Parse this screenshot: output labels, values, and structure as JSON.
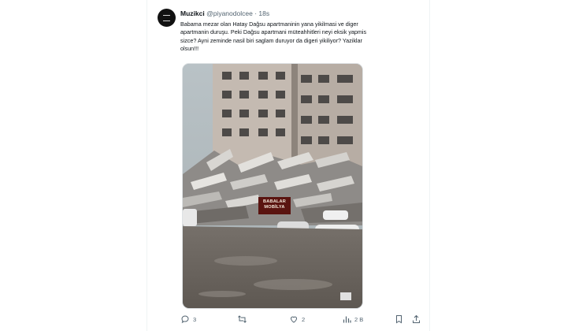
{
  "tweet": {
    "author_name": "Muzikci",
    "author_handle": "@piyanodolcee",
    "separator": "·",
    "timestamp": "18s",
    "text": "Babama mezar olan Hatay Dağsu apartmaninin yana yikilmasi ve diger\napartmanin duruşu. Peki Dağsu apartmani müteahhitleri neyi eksik yapmis\nsizce? Ayni zeminde nasil biri saglam duruyor da digeri yikiliyor? Yaziklar\nolsun!!!",
    "media": {
      "sign_text_line1": "BABALAR",
      "sign_text_line2": "MOBİLYA"
    },
    "actions": {
      "reply_count": "3",
      "retweet_count": "",
      "like_count": "2",
      "view_count": "2 B"
    }
  },
  "colors": {
    "text_primary": "#0f1419",
    "text_secondary": "#536471",
    "divider": "#eff3f4"
  },
  "icons": [
    "reply-icon",
    "retweet-icon",
    "like-icon",
    "views-icon",
    "bookmark-icon",
    "share-icon"
  ]
}
